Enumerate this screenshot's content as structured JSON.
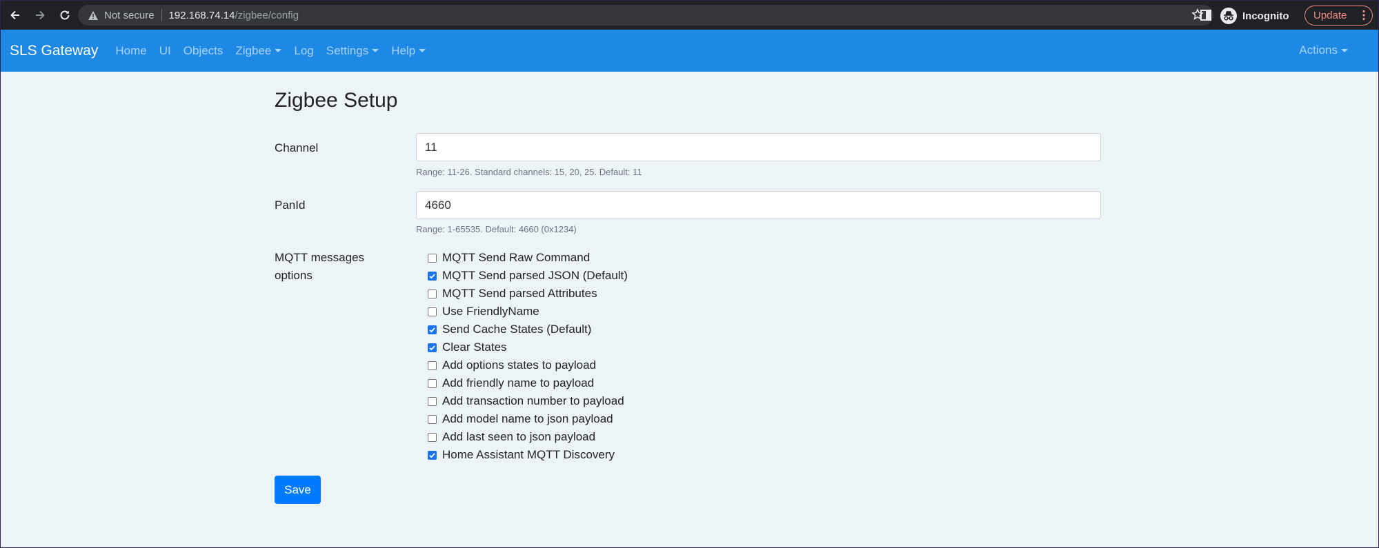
{
  "browser": {
    "security_label": "Not secure",
    "url_host": "192.168.74.14",
    "url_path": "/zigbee/config",
    "profile_label": "Incognito",
    "update_label": "Update"
  },
  "navbar": {
    "brand": "SLS Gateway",
    "items": [
      {
        "label": "Home"
      },
      {
        "label": "UI"
      },
      {
        "label": "Objects"
      },
      {
        "label": "Zigbee"
      },
      {
        "label": "Log"
      },
      {
        "label": "Settings"
      },
      {
        "label": "Help"
      }
    ],
    "actions_label": "Actions"
  },
  "page": {
    "title": "Zigbee Setup",
    "channel": {
      "label": "Channel",
      "value": "11",
      "help": "Range: 11-26. Standard channels: 15, 20, 25. Default: 11"
    },
    "panid": {
      "label": "PanId",
      "value": "4660",
      "help": "Range: 1-65535. Default: 4660 (0x1234)"
    },
    "mqtt": {
      "label_line1": "MQTT messages",
      "label_line2": "options",
      "options": [
        {
          "label": "MQTT Send Raw Command",
          "checked": false
        },
        {
          "label": "MQTT Send parsed JSON (Default)",
          "checked": true
        },
        {
          "label": "MQTT Send parsed Attributes",
          "checked": false
        },
        {
          "label": "Use FriendlyName",
          "checked": false
        },
        {
          "label": "Send Cache States (Default)",
          "checked": true
        },
        {
          "label": "Clear States",
          "checked": true
        },
        {
          "label": "Add options states to payload",
          "checked": false
        },
        {
          "label": "Add friendly name to payload",
          "checked": false
        },
        {
          "label": "Add transaction number to payload",
          "checked": false
        },
        {
          "label": "Add model name to json payload",
          "checked": false
        },
        {
          "label": "Add last seen to json payload",
          "checked": false
        },
        {
          "label": "Home Assistant MQTT Discovery",
          "checked": true
        }
      ]
    },
    "save_label": "Save"
  },
  "colors": {
    "navbar": "#1e88e5",
    "primary_button": "#007bff",
    "checkbox_checked": "#1a73e8"
  }
}
